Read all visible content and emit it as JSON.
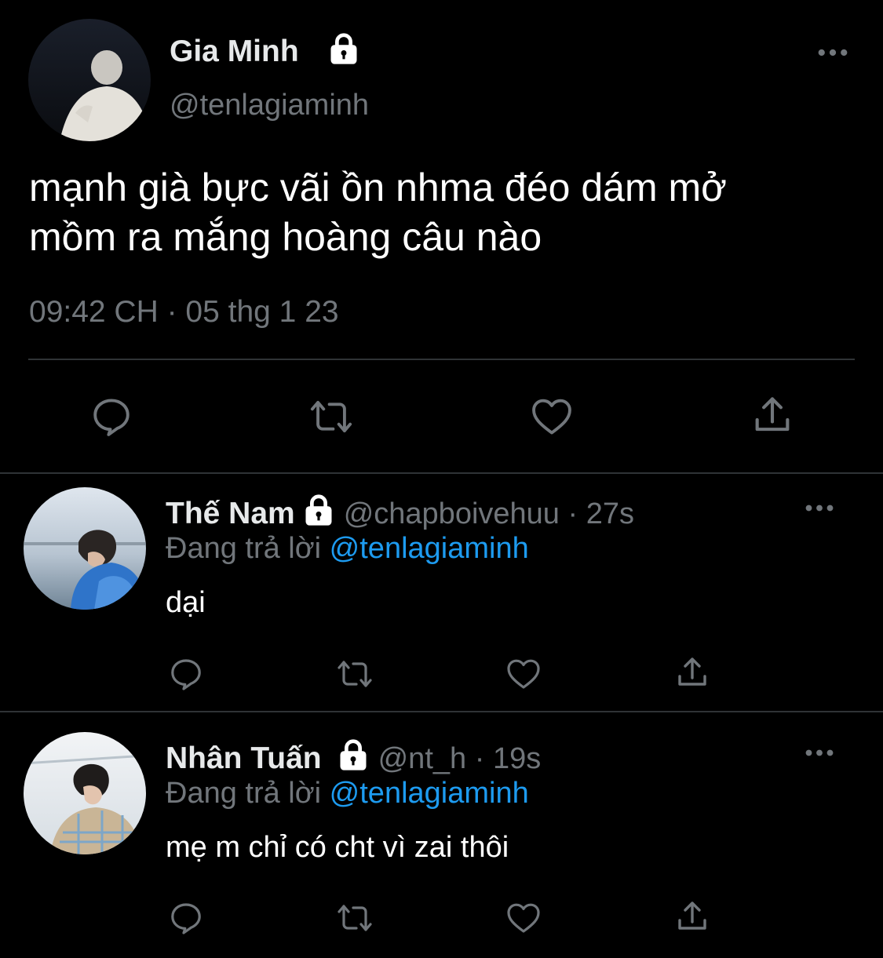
{
  "main_tweet": {
    "display_name": "Gia Minh",
    "handle": "@tenlagiaminh",
    "text_line1": "mạnh già bực vãi ồn nhma đéo dám mở",
    "text_line2": "mồm ra mắng hoàng câu nào",
    "timestamp": "09:42 CH · 05 thg 1 23",
    "protected": true
  },
  "replies": [
    {
      "display_name": "Thế Nam",
      "handle": "@chapboivehuu",
      "age": "27s",
      "replying_prefix": "Đang trả lời",
      "replying_to": "@tenlagiaminh",
      "text": "dại",
      "protected": true
    },
    {
      "display_name": "Nhân Tuấn",
      "handle": "@nt_h",
      "age": "19s",
      "replying_prefix": "Đang trả lời",
      "replying_to": "@tenlagiaminh",
      "text": "mẹ m chỉ có cht vì zai thôi",
      "protected": true
    }
  ],
  "icons": {
    "reply": "reply-icon",
    "retweet": "retweet-icon",
    "like": "heart-icon",
    "share": "share-icon",
    "more": "more-icon",
    "lock": "lock-icon"
  },
  "colors": {
    "background": "#000000",
    "text_primary": "#e7e9ea",
    "text_secondary": "#71767b",
    "accent": "#1d9bf0",
    "divider": "#2f3336"
  }
}
